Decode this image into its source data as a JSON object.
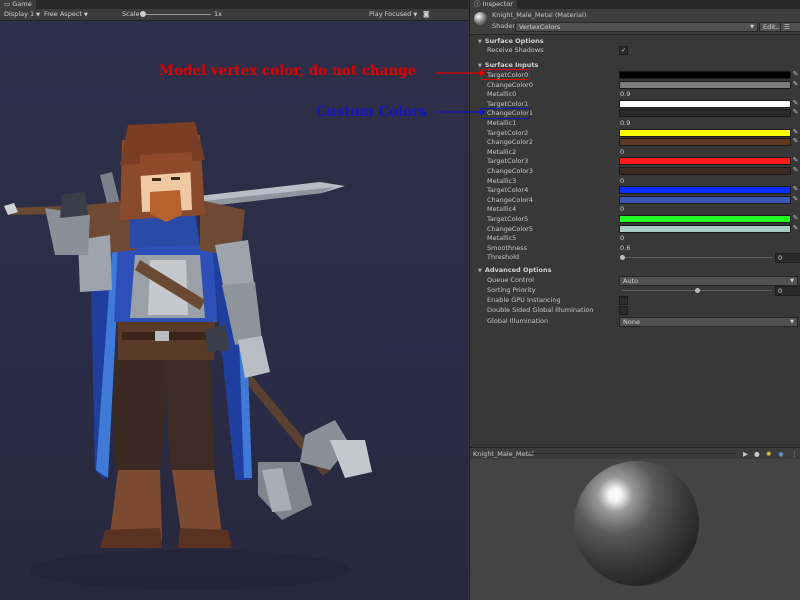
{
  "game": {
    "tab_label": "Game",
    "display": "Display 1",
    "aspect": "Free Aspect",
    "scale_label": "Scale",
    "scale_value": "1x",
    "play_mode": "Play Focused",
    "icons": [
      "game-view-icon",
      "camera-icon"
    ]
  },
  "annotations": {
    "vertex_note": "Model vertex color, do not change",
    "custom_note": "Custom Colors",
    "vertex_color": "#e00000",
    "custom_color": "#1515c8"
  },
  "inspector": {
    "tab_label": "Inspector",
    "material_name": "Knight_Male_Metal (Material)",
    "shader_label": "Shader",
    "shader_value": "VertexColors",
    "edit_button": "Edit...",
    "list_button": "☰"
  },
  "surface_options": {
    "title": "Surface Options",
    "receive_shadows_label": "Receive Shadows",
    "receive_shadows": true
  },
  "surface_inputs": {
    "title": "Surface Inputs",
    "rows": [
      {
        "label": "TargetColor0",
        "kind": "color",
        "color": "#000000"
      },
      {
        "label": "ChangeColor0",
        "kind": "color",
        "color": "#7c7c7c"
      },
      {
        "label": "Metallic0",
        "kind": "float",
        "value": "0.9"
      },
      {
        "label": "TargetColor1",
        "kind": "color",
        "color": "#ffffff"
      },
      {
        "label": "ChangeColor1",
        "kind": "color",
        "color": "#292929"
      },
      {
        "label": "Metallic1",
        "kind": "float",
        "value": "0.9"
      },
      {
        "label": "TargetColor2",
        "kind": "color",
        "color": "#ffff00"
      },
      {
        "label": "ChangeColor2",
        "kind": "color",
        "color": "#5e3a22"
      },
      {
        "label": "Metallic2",
        "kind": "float",
        "value": "0"
      },
      {
        "label": "TargetColor3",
        "kind": "color",
        "color": "#ff1a1a"
      },
      {
        "label": "ChangeColor3",
        "kind": "color",
        "color": "#3b2a22"
      },
      {
        "label": "Metallic3",
        "kind": "float",
        "value": "0"
      },
      {
        "label": "TargetColor4",
        "kind": "color",
        "color": "#0a2eff"
      },
      {
        "label": "ChangeColor4",
        "kind": "color",
        "color": "#3a55b8"
      },
      {
        "label": "Metallic4",
        "kind": "float",
        "value": "0"
      },
      {
        "label": "TargetColor5",
        "kind": "color",
        "color": "#22ff22"
      },
      {
        "label": "ChangeColor5",
        "kind": "color",
        "color": "#a9ccc4"
      },
      {
        "label": "Metallic5",
        "kind": "float",
        "value": "0"
      },
      {
        "label": "Smoothness",
        "kind": "float",
        "value": "0.6"
      },
      {
        "label": "Threshold",
        "kind": "slider",
        "value": "0",
        "level": 0
      }
    ]
  },
  "advanced_options": {
    "title": "Advanced Options",
    "queue_control_label": "Queue Control",
    "queue_control_value": "Auto",
    "sorting_priority_label": "Sorting Priority",
    "sorting_priority_value": "0",
    "sorting_priority_level": 0.5,
    "gpu_instancing_label": "Enable GPU Instancing",
    "gpu_instancing": false,
    "double_sided_gi_label": "Double Sided Global Illumination",
    "double_sided_gi": false,
    "global_illumination_label": "Global Illumination",
    "global_illumination_value": "None"
  },
  "preview": {
    "title": "Knight_Male_Metal",
    "icons": [
      "play-icon",
      "sphere-shape-icon",
      "light-icon",
      "background-icon",
      "more-icon"
    ]
  }
}
